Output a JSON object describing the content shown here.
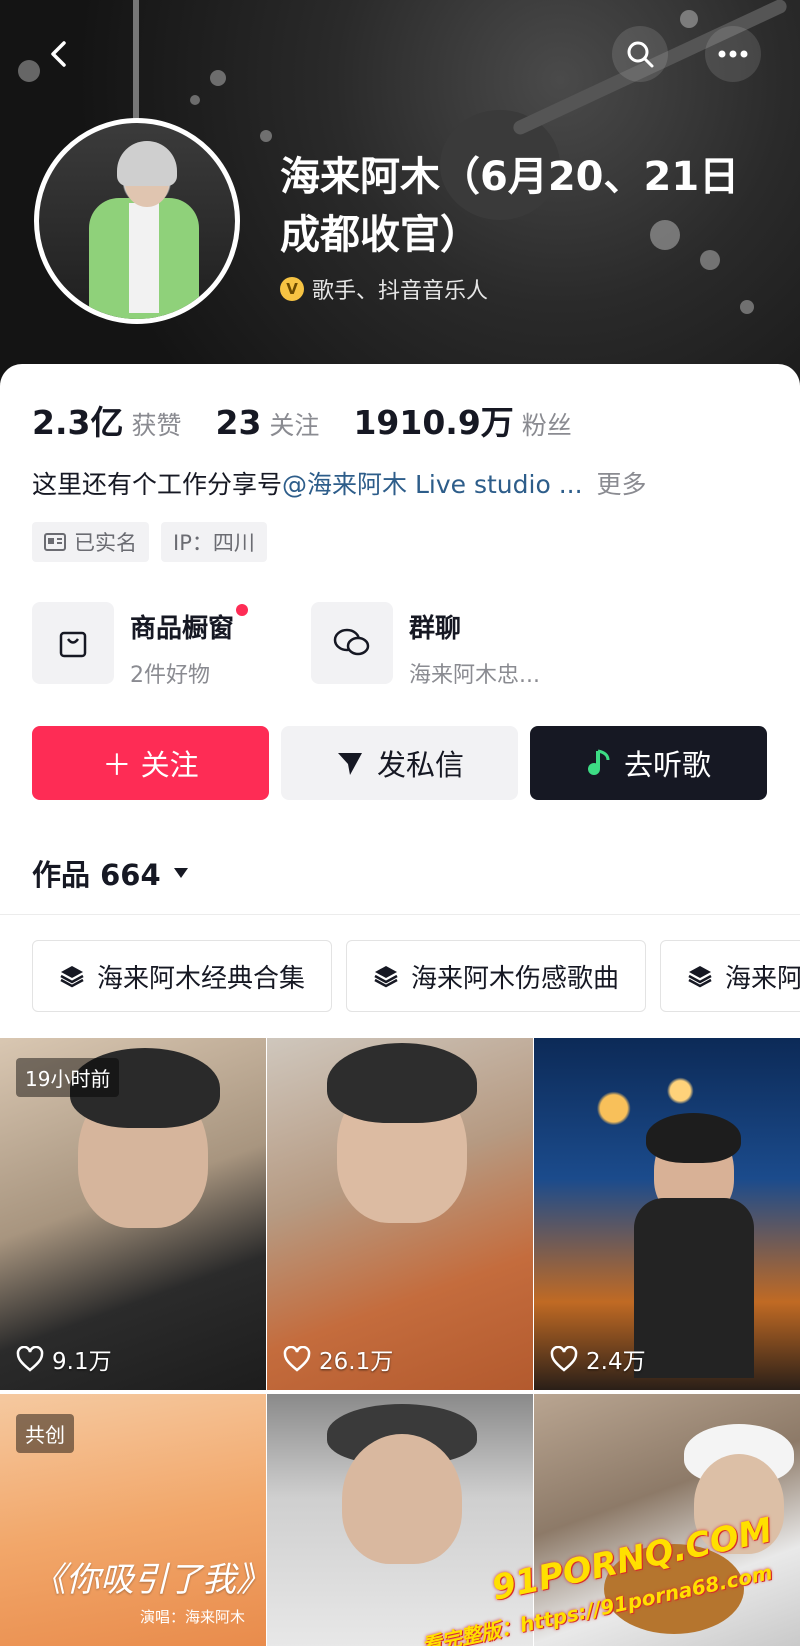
{
  "header": {
    "name": "海来阿木（6月20、21日成都收官）",
    "verify_label": "歌手、抖音音乐人",
    "verify_badge": "V"
  },
  "stats": [
    {
      "num": "2.3亿",
      "label": "获赞"
    },
    {
      "num": "23",
      "label": "关注"
    },
    {
      "num": "1910.9万",
      "label": "粉丝"
    }
  ],
  "bio": {
    "text": "这里还有个工作分享号",
    "mention": "@海来阿木 Live studio ...",
    "more": "更多"
  },
  "tags": [
    "已实名",
    "IP：四川"
  ],
  "entries": {
    "shop": {
      "title": "商品橱窗",
      "subtitle": "2件好物"
    },
    "group": {
      "title": "群聊",
      "subtitle": "海来阿木忠..."
    }
  },
  "buttons": {
    "follow": "＋ 关注",
    "message": "发私信",
    "listen": "去听歌"
  },
  "works": {
    "label": "作品 664"
  },
  "collections": [
    "海来阿木经典合集",
    "海来阿木伤感歌曲",
    "海来阿"
  ],
  "videos": [
    {
      "badge": "19小时前",
      "likes": "9.1万"
    },
    {
      "badge": "",
      "likes": "26.1万"
    },
    {
      "badge": "",
      "likes": "2.4万"
    },
    {
      "badge": "共创",
      "likes": "",
      "title": "《你吸引了我》",
      "credit": "演唱：海来阿木"
    },
    {
      "badge": "",
      "likes": ""
    },
    {
      "badge": "",
      "likes": ""
    }
  ],
  "watermark": {
    "line1": "91PORNQ.COM",
    "line2": "看完整版：https://91porna68.com"
  },
  "colors": {
    "accent": "#fe2c55",
    "dark_button": "#161823",
    "link": "#2d5d8a"
  }
}
